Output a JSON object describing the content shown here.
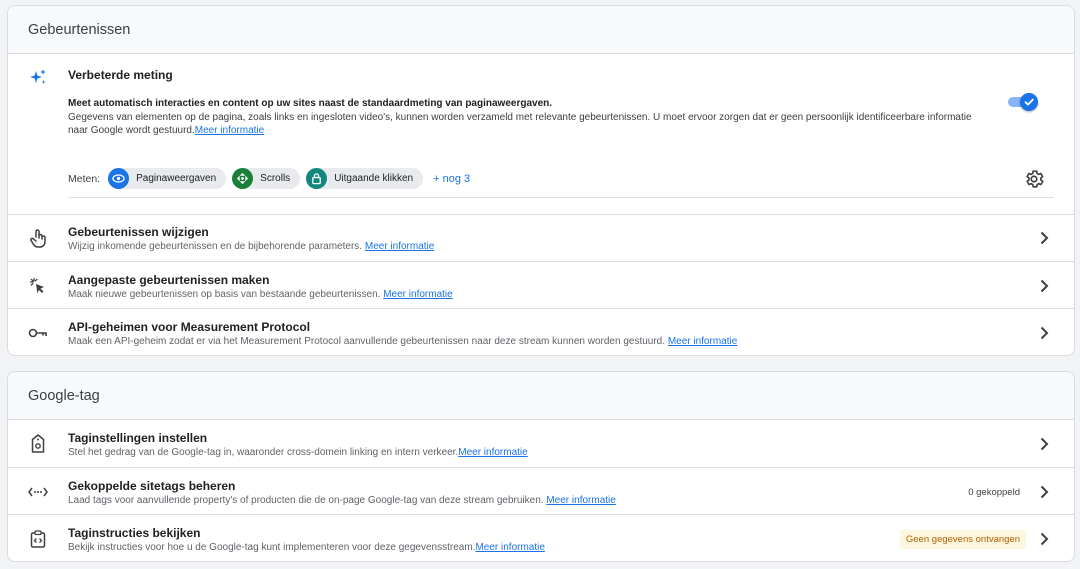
{
  "events_card": {
    "title": "Gebeurtenissen",
    "enhanced": {
      "icon": "sparkle-icon",
      "title": "Verbeterde meting",
      "desc_strong": "Meet automatisch interacties en content op uw sites naast de standaardmeting van paginaweergaven.",
      "desc": "Gegevens van elementen op de pagina, zoals links en ingesloten video's, kunnen worden verzameld met relevante gebeurtenissen. U moet ervoor zorgen dat er geen persoonlijk identificeerbare informatie naar Google wordt gestuurd.",
      "link": "Meer informatie",
      "toggle_on": true,
      "measure_label": "Meten:",
      "chips": [
        {
          "label": "Paginaweergaven",
          "icon": "eye-icon",
          "color": "#1a73e8"
        },
        {
          "label": "Scrolls",
          "icon": "scroll-icon",
          "color": "#188038"
        },
        {
          "label": "Uitgaande klikken",
          "icon": "lock-icon",
          "color": "#12877d"
        }
      ],
      "more": "+ nog 3"
    },
    "rows": [
      {
        "title": "Gebeurtenissen wijzigen",
        "desc": "Wijzig inkomende gebeurtenissen en de bijbehorende parameters.",
        "link": "Meer informatie",
        "icon": "touch-icon"
      },
      {
        "title": "Aangepaste gebeurtenissen maken",
        "desc": "Maak nieuwe gebeurtenissen op basis van bestaande gebeurtenissen.",
        "link": "Meer informatie",
        "icon": "cursor-click-icon"
      },
      {
        "title": "API-geheimen voor Measurement Protocol",
        "desc": "Maak een API-geheim zodat er via het Measurement Protocol aanvullende gebeurtenissen naar deze stream kunnen worden gestuurd.",
        "link": "Meer informatie",
        "icon": "key-icon"
      }
    ]
  },
  "tag_card": {
    "title": "Google-tag",
    "rows": [
      {
        "title": "Taginstellingen instellen",
        "desc": "Stel het gedrag van de Google-tag in, waaronder cross-domein linking en intern verkeer.",
        "link": "Meer informatie",
        "icon": "tag-settings-icon",
        "badge": ""
      },
      {
        "title": "Gekoppelde sitetags beheren",
        "desc": "Laad tags voor aanvullende property's of producten die de on-page Google-tag van deze stream gebruiken.",
        "link": "Meer informatie",
        "icon": "code-arrows-icon",
        "badge": "0 gekoppeld"
      },
      {
        "title": "Taginstructies bekijken",
        "desc": "Bekijk instructies voor hoe u de Google-tag kunt implementeren voor deze gegevensstream.",
        "link": "Meer informatie",
        "icon": "code-clipboard-icon",
        "badge": "Geen gegevens ontvangen"
      }
    ]
  }
}
